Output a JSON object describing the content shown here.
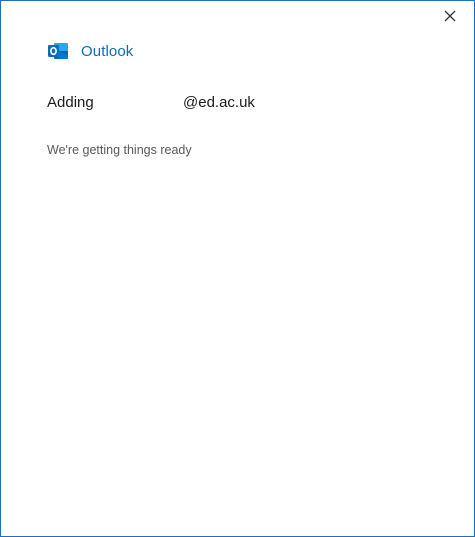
{
  "window": {
    "close_icon": "close-icon"
  },
  "brand": {
    "logo_icon": "outlook-logo-icon",
    "app_name": "Outlook",
    "accent_color": "#0f6cbd"
  },
  "account": {
    "action_label": "Adding",
    "email": "@ed.ac.uk"
  },
  "status": {
    "message": "We're getting things ready"
  }
}
